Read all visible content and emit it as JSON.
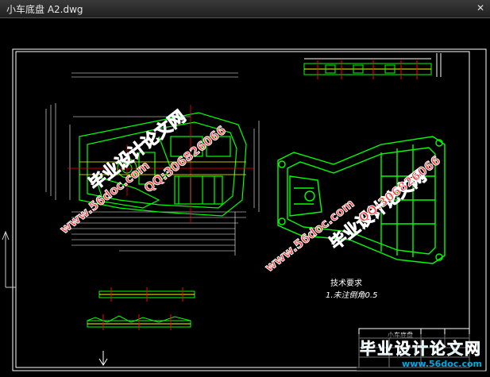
{
  "window": {
    "title": "小车底盘 A2.dwg",
    "close_glyph": "✕"
  },
  "drawing": {
    "tech_req_title": "技术要求",
    "tech_req_item": "1.未注倒角0.5",
    "title_block_name": "小车底盘",
    "colors": {
      "frame": "#ffffff",
      "part": "#00ff00",
      "dim": "#ffffff",
      "center": "#ff0000",
      "accent": "#ffff00"
    }
  },
  "watermarks": [
    {
      "text": "毕业设计论文网",
      "kind": "big"
    },
    {
      "text": "www.56doc.com",
      "kind": "small"
    },
    {
      "text": "QQ:306826066",
      "kind": "small"
    },
    {
      "text": "毕业设计论文网",
      "kind": "big"
    },
    {
      "text": "www.56doc.com",
      "kind": "small"
    },
    {
      "text": "QQ:306826066",
      "kind": "small"
    }
  ],
  "brand": {
    "name": "毕业设计论文网",
    "url": "www.56doc.com"
  }
}
